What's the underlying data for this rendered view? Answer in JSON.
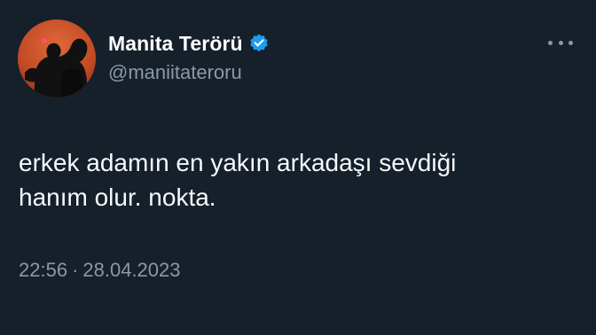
{
  "author": {
    "display_name": "Manita Terörü",
    "handle": "@maniitateroru",
    "verified": true,
    "verified_color": "#1d9bf0"
  },
  "tweet": {
    "text_lines": [
      "erkek adamın en yakın arkadaşı sevdiği",
      "hanım olur. nokta."
    ],
    "time": "22:56",
    "separator": "·",
    "date": "28.04.2023"
  },
  "icons": {
    "more": "more-horizontal-icon",
    "verified": "verified-badge-icon"
  },
  "colors": {
    "background": "#15202b",
    "text_primary": "#f7f9f9",
    "text_secondary": "#8b98a5",
    "avatar_background": "#c8502a"
  }
}
